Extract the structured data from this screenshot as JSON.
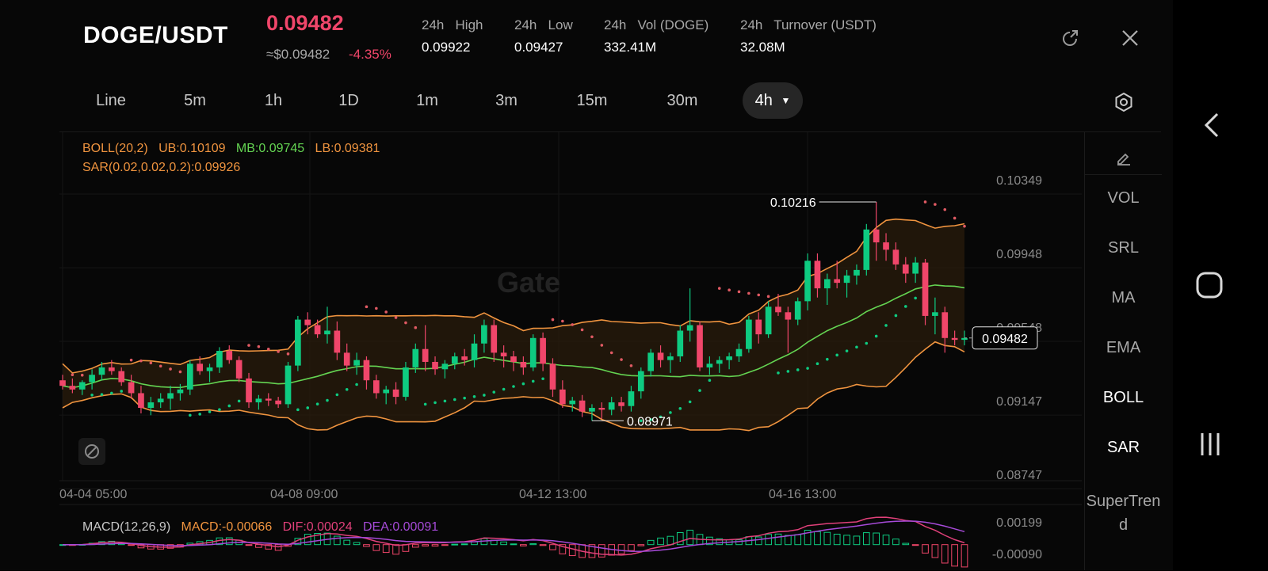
{
  "header": {
    "pair": "DOGE/USDT",
    "price": "0.09482",
    "usd_price": "≈$0.09482",
    "change": "-4.35%",
    "stats": [
      {
        "label": "24h   High",
        "value": "0.09922"
      },
      {
        "label": "24h   Low",
        "value": "0.09427"
      },
      {
        "label": "24h   Vol (DOGE)",
        "value": "332.41M"
      },
      {
        "label": "24h   Turnover (USDT)",
        "value": "32.08M"
      }
    ],
    "icons": {
      "share": "share-icon",
      "close": "close-icon"
    }
  },
  "tabs": {
    "items": [
      "Line",
      "5m",
      "1h",
      "1D",
      "1m",
      "3m",
      "15m",
      "30m",
      "4h"
    ],
    "active": "4h",
    "settings_icon": "settings-icon"
  },
  "chart": {
    "legend": {
      "boll": "BOLL(20,2)",
      "ub": "UB:0.10109",
      "mb": "MB:0.09745",
      "lb": "LB:0.09381",
      "sar": "SAR(0.02,0.02,0.2):0.09926"
    },
    "watermark": "Gate",
    "price_axis": [
      "0.10349",
      "0.09948",
      "0.09548",
      "0.09147",
      "0.08747"
    ],
    "time_axis": [
      "04-04 05:00",
      "04-08 09:00",
      "04-12 13:00",
      "04-16 13:00"
    ],
    "high_label": "0.10216",
    "low_label": "0.08971",
    "last_price_label": "0.09482",
    "macd_legend": {
      "name": "MACD(12,26,9)",
      "macd": "MACD:-0.00066",
      "dif": "DIF:0.00024",
      "dea": "DEA:0.00091"
    },
    "macd_axis": [
      "0.00199",
      "-0.00090"
    ],
    "colors": {
      "up": "#0ecb81",
      "down": "#f0466a",
      "boll_band": "#f0943f",
      "mid": "#64d452",
      "sar": "#e05a63",
      "dif": "#e0407a",
      "dea": "#a64ad8"
    }
  },
  "chart_data": {
    "type": "candlestick",
    "interval": "4h",
    "ylim": [
      0.08747,
      0.10349
    ],
    "ohlc": [
      [
        0.0925,
        0.0928,
        0.092,
        0.0922
      ],
      [
        0.0922,
        0.0926,
        0.0918,
        0.092
      ],
      [
        0.092,
        0.0925,
        0.0917,
        0.0924
      ],
      [
        0.0924,
        0.0931,
        0.092,
        0.0928
      ],
      [
        0.0928,
        0.0935,
        0.0925,
        0.0932
      ],
      [
        0.0932,
        0.0936,
        0.0928,
        0.093
      ],
      [
        0.093,
        0.0932,
        0.0922,
        0.0924
      ],
      [
        0.0924,
        0.0928,
        0.0915,
        0.0918
      ],
      [
        0.0918,
        0.0922,
        0.0907,
        0.091
      ],
      [
        0.091,
        0.0916,
        0.0906,
        0.0913
      ],
      [
        0.0913,
        0.0918,
        0.091,
        0.0915
      ],
      [
        0.0915,
        0.0922,
        0.0909,
        0.0918
      ],
      [
        0.0918,
        0.0923,
        0.0914,
        0.092
      ],
      [
        0.092,
        0.0936,
        0.0917,
        0.0934
      ],
      [
        0.0934,
        0.0938,
        0.0928,
        0.093
      ],
      [
        0.093,
        0.0934,
        0.0924,
        0.0932
      ],
      [
        0.0932,
        0.0943,
        0.0929,
        0.0941
      ],
      [
        0.0941,
        0.0944,
        0.0934,
        0.0936
      ],
      [
        0.0936,
        0.0938,
        0.0924,
        0.0926
      ],
      [
        0.0926,
        0.0929,
        0.091,
        0.0913
      ],
      [
        0.0913,
        0.0917,
        0.0909,
        0.0915
      ],
      [
        0.0915,
        0.0918,
        0.0911,
        0.0914
      ],
      [
        0.0914,
        0.0916,
        0.091,
        0.0912
      ],
      [
        0.0912,
        0.0935,
        0.091,
        0.0933
      ],
      [
        0.0933,
        0.096,
        0.093,
        0.0958
      ],
      [
        0.0958,
        0.0962,
        0.095,
        0.0955
      ],
      [
        0.0955,
        0.0958,
        0.0948,
        0.095
      ],
      [
        0.095,
        0.0965,
        0.0945,
        0.0952
      ],
      [
        0.0952,
        0.0957,
        0.0936,
        0.094
      ],
      [
        0.094,
        0.0945,
        0.093,
        0.0933
      ],
      [
        0.0933,
        0.094,
        0.0928,
        0.0936
      ],
      [
        0.0936,
        0.0938,
        0.092,
        0.0925
      ],
      [
        0.0925,
        0.0928,
        0.0915,
        0.0918
      ],
      [
        0.0918,
        0.0922,
        0.0912,
        0.092
      ],
      [
        0.092,
        0.0924,
        0.0912,
        0.0916
      ],
      [
        0.0916,
        0.0935,
        0.0914,
        0.0932
      ],
      [
        0.0932,
        0.0945,
        0.0929,
        0.0942
      ],
      [
        0.0942,
        0.0955,
        0.093,
        0.0935
      ],
      [
        0.0935,
        0.0938,
        0.0928,
        0.0931
      ],
      [
        0.0931,
        0.0936,
        0.0926,
        0.0934
      ],
      [
        0.0934,
        0.094,
        0.0931,
        0.0938
      ],
      [
        0.0938,
        0.0942,
        0.0933,
        0.0936
      ],
      [
        0.0936,
        0.095,
        0.0932,
        0.0945
      ],
      [
        0.0945,
        0.0958,
        0.094,
        0.0955
      ],
      [
        0.0955,
        0.0958,
        0.0935,
        0.094
      ],
      [
        0.094,
        0.0944,
        0.0932,
        0.0938
      ],
      [
        0.0938,
        0.0941,
        0.093,
        0.0935
      ],
      [
        0.0935,
        0.0938,
        0.0928,
        0.0932
      ],
      [
        0.0932,
        0.095,
        0.093,
        0.0948
      ],
      [
        0.0948,
        0.0951,
        0.093,
        0.0934
      ],
      [
        0.0934,
        0.0937,
        0.0916,
        0.092
      ],
      [
        0.092,
        0.0925,
        0.091,
        0.0912
      ],
      [
        0.0912,
        0.0916,
        0.0908,
        0.0914
      ],
      [
        0.0914,
        0.0917,
        0.0905,
        0.0908
      ],
      [
        0.0908,
        0.0912,
        0.0903,
        0.091
      ],
      [
        0.091,
        0.0913,
        0.0904,
        0.0909
      ],
      [
        0.0909,
        0.0916,
        0.0906,
        0.0913
      ],
      [
        0.0913,
        0.0916,
        0.0908,
        0.0911
      ],
      [
        0.0911,
        0.0922,
        0.0908,
        0.0919
      ],
      [
        0.0919,
        0.0932,
        0.0915,
        0.093
      ],
      [
        0.093,
        0.0942,
        0.0927,
        0.094
      ],
      [
        0.094,
        0.0944,
        0.0932,
        0.0936
      ],
      [
        0.0936,
        0.094,
        0.0929,
        0.0938
      ],
      [
        0.0938,
        0.0955,
        0.0935,
        0.0952
      ],
      [
        0.0952,
        0.0975,
        0.0946,
        0.0955
      ],
      [
        0.0955,
        0.0957,
        0.093,
        0.0932
      ],
      [
        0.0932,
        0.0938,
        0.0928,
        0.0934
      ],
      [
        0.0934,
        0.0938,
        0.0929,
        0.0936
      ],
      [
        0.0936,
        0.094,
        0.0931,
        0.0938
      ],
      [
        0.0938,
        0.0945,
        0.0935,
        0.0942
      ],
      [
        0.0942,
        0.096,
        0.094,
        0.0958
      ],
      [
        0.0958,
        0.0962,
        0.0945,
        0.095
      ],
      [
        0.095,
        0.0968,
        0.0948,
        0.0965
      ],
      [
        0.0965,
        0.0972,
        0.096,
        0.0962
      ],
      [
        0.0962,
        0.0965,
        0.094,
        0.0958
      ],
      [
        0.0958,
        0.097,
        0.0955,
        0.0968
      ],
      [
        0.0968,
        0.0994,
        0.0963,
        0.099
      ],
      [
        0.099,
        0.0994,
        0.097,
        0.0975
      ],
      [
        0.0975,
        0.0983,
        0.0966,
        0.098
      ],
      [
        0.098,
        0.099,
        0.0975,
        0.0978
      ],
      [
        0.0978,
        0.0985,
        0.097,
        0.0982
      ],
      [
        0.0982,
        0.0988,
        0.0977,
        0.0985
      ],
      [
        0.0985,
        0.101,
        0.0982,
        0.1007
      ],
      [
        0.1007,
        0.1022,
        0.099,
        0.1
      ],
      [
        0.1,
        0.1005,
        0.099,
        0.0996
      ],
      [
        0.0996,
        0.1,
        0.0985,
        0.0988
      ],
      [
        0.0988,
        0.0992,
        0.0978,
        0.0983
      ],
      [
        0.0983,
        0.0992,
        0.0978,
        0.0989
      ],
      [
        0.0989,
        0.0991,
        0.0955,
        0.096
      ],
      [
        0.096,
        0.097,
        0.095,
        0.0962
      ],
      [
        0.0962,
        0.0965,
        0.094,
        0.0948
      ],
      [
        0.0948,
        0.0952,
        0.0944,
        0.0947
      ],
      [
        0.0947,
        0.0952,
        0.0944,
        0.0948
      ]
    ],
    "series": [
      {
        "name": "UB",
        "last": 0.10109
      },
      {
        "name": "MB",
        "last": 0.09745
      },
      {
        "name": "LB",
        "last": 0.09381
      },
      {
        "name": "SAR",
        "last": 0.09926
      },
      {
        "name": "MACD",
        "last": -0.00066
      },
      {
        "name": "DIF",
        "last": 0.00024
      },
      {
        "name": "DEA",
        "last": 0.00091
      }
    ],
    "macd_ylim": [
      -0.0009,
      0.00199
    ]
  },
  "side_panel": {
    "edit_icon": "edit-icon",
    "items": [
      "VOL",
      "SRL",
      "MA",
      "EMA",
      "BOLL",
      "SAR",
      "SuperTrend"
    ],
    "active": [
      "BOLL",
      "SAR"
    ]
  },
  "system_nav": {
    "back": "back-icon",
    "home": "home-icon",
    "recents": "recents-icon"
  }
}
